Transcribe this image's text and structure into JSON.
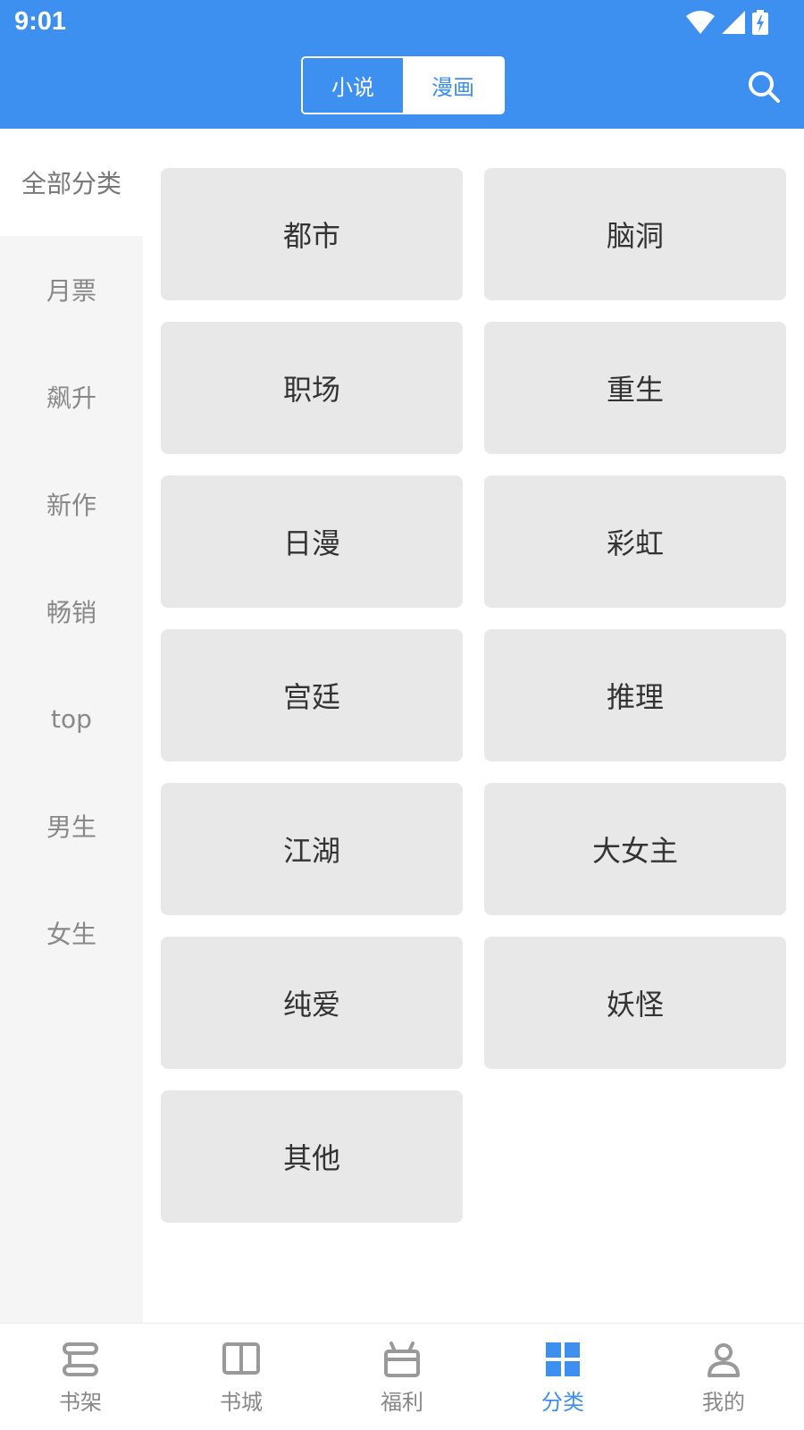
{
  "status_bar": {
    "time": "9:01",
    "icons": [
      "wifi-icon",
      "signal-icon",
      "battery-charging-icon"
    ]
  },
  "header": {
    "tabs": [
      {
        "label": "小说",
        "active": true
      },
      {
        "label": "漫画",
        "active": false
      }
    ],
    "search_icon": "search-icon"
  },
  "sidebar": {
    "items": [
      {
        "label": "全部分类",
        "active": true
      },
      {
        "label": "月票",
        "active": false
      },
      {
        "label": "飙升",
        "active": false
      },
      {
        "label": "新作",
        "active": false
      },
      {
        "label": "畅销",
        "active": false
      },
      {
        "label": "top",
        "active": false
      },
      {
        "label": "男生",
        "active": false
      },
      {
        "label": "女生",
        "active": false
      }
    ]
  },
  "categories": [
    "都市",
    "脑洞",
    "职场",
    "重生",
    "日漫",
    "彩虹",
    "宫廷",
    "推理",
    "江湖",
    "大女主",
    "纯爱",
    "妖怪",
    "其他"
  ],
  "bottom_nav": {
    "items": [
      {
        "label": "书架",
        "icon": "bookshelf-icon",
        "active": false
      },
      {
        "label": "书城",
        "icon": "open-book-icon",
        "active": false
      },
      {
        "label": "福利",
        "icon": "gift-icon",
        "active": false
      },
      {
        "label": "分类",
        "icon": "grid-icon",
        "active": true
      },
      {
        "label": "我的",
        "icon": "user-icon",
        "active": false
      }
    ]
  },
  "colors": {
    "accent": "#3d8ff0",
    "card": "#e8e8e8",
    "sidebar_bg": "#f5f5f5",
    "inactive_text": "#888888"
  }
}
